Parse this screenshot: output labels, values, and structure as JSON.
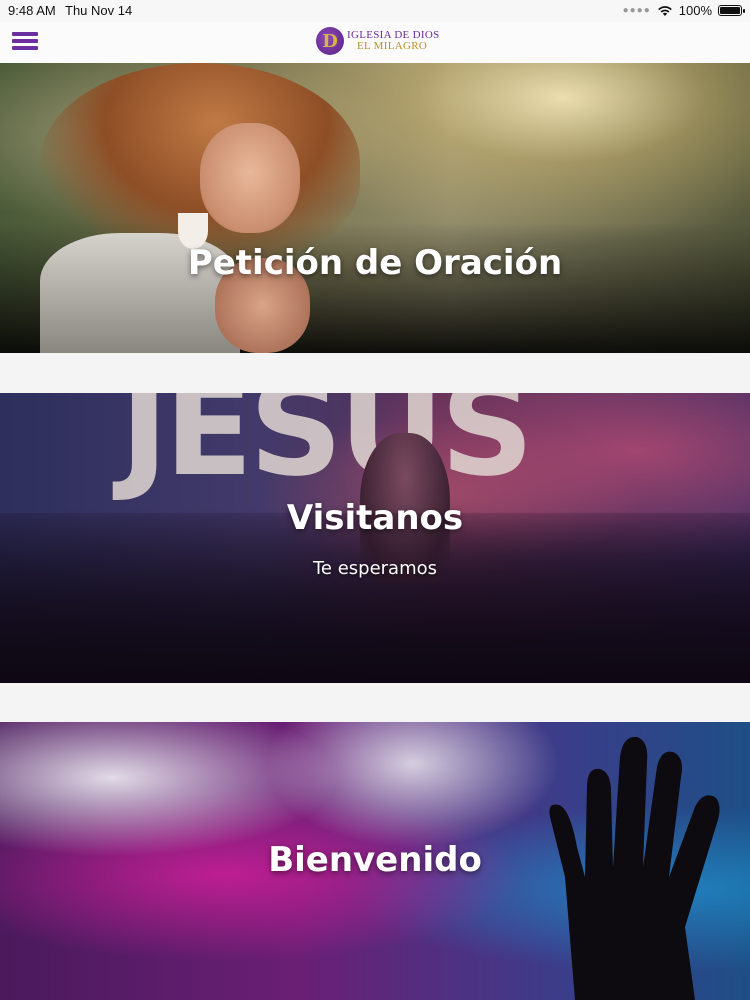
{
  "status_bar": {
    "time": "9:48 AM",
    "date": "Thu Nov 14",
    "battery": "100%",
    "battery_level": 1.0
  },
  "header": {
    "logo_line1": "IGLESIA DE DIOS",
    "logo_line2": "EL MILAGRO",
    "logo_mark": "D",
    "accent_color": "#6d2fa0",
    "gold_color": "#b8912e"
  },
  "cards": [
    {
      "title": "Petición de Oración",
      "subtitle": ""
    },
    {
      "title": "Visitanos",
      "subtitle": "Te esperamos"
    },
    {
      "title": "Bienvenido",
      "subtitle": ""
    }
  ],
  "icons": {
    "menu": "hamburger-menu-icon",
    "wifi": "wifi-icon",
    "battery": "battery-icon"
  }
}
